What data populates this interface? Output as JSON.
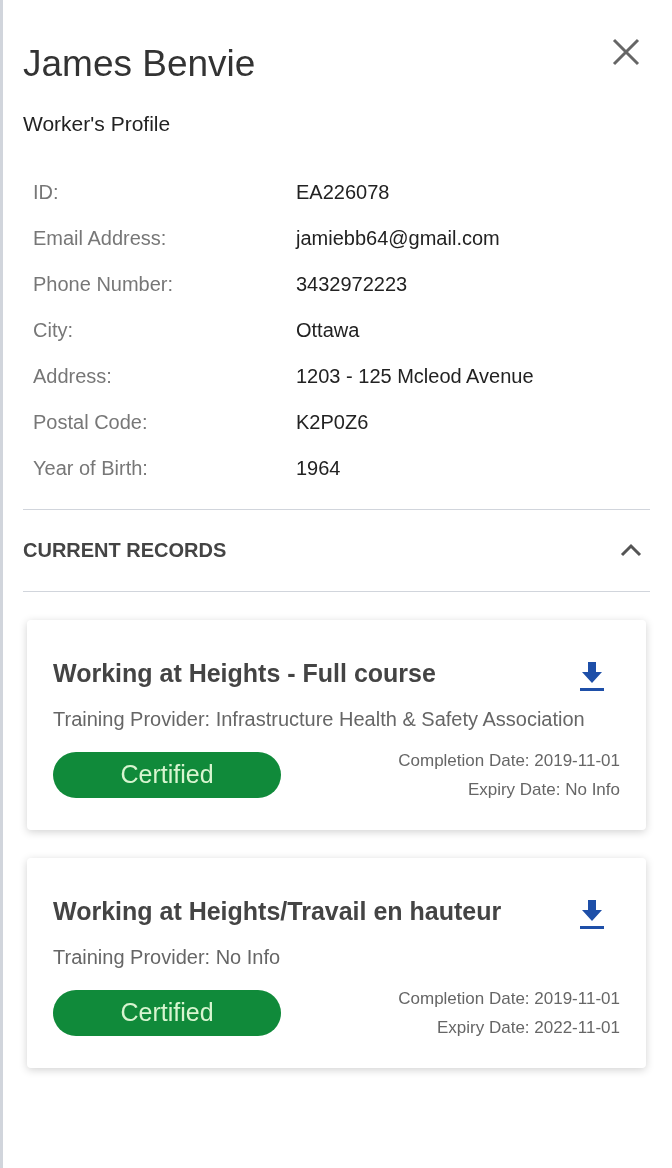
{
  "header": {
    "name": "James Benvie",
    "subtitle": "Worker's Profile"
  },
  "details": [
    {
      "label": "ID:",
      "value": "EA226078"
    },
    {
      "label": "Email Address:",
      "value": "jamiebb64@gmail.com"
    },
    {
      "label": "Phone Number:",
      "value": "3432972223"
    },
    {
      "label": "City:",
      "value": "Ottawa"
    },
    {
      "label": "Address:",
      "value": "1203 - 125 Mcleod Avenue"
    },
    {
      "label": "Postal Code:",
      "value": "K2P0Z6"
    },
    {
      "label": "Year of Birth:",
      "value": "1964"
    }
  ],
  "records_section": {
    "title": "CURRENT RECORDS",
    "expanded": true,
    "records": [
      {
        "title": "Working at Heights - Full course",
        "provider": "Training Provider: Infrastructure Health & Safety Association",
        "status": "Certified",
        "completion": "Completion Date: 2019-11-01",
        "expiry": "Expiry Date: No Info"
      },
      {
        "title": "Working at Heights/Travail en hauteur",
        "provider": "Training Provider: No Info",
        "status": "Certified",
        "completion": "Completion Date: 2019-11-01",
        "expiry": "Expiry Date: 2022-11-01"
      }
    ]
  }
}
